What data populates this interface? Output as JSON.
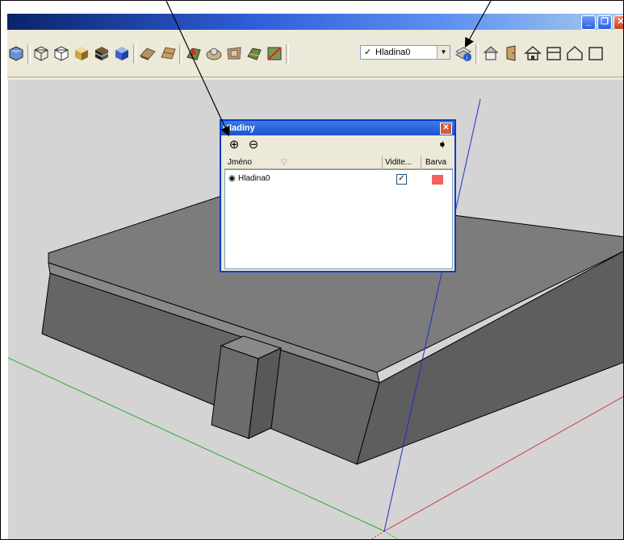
{
  "toolbar": {
    "layer_dropdown": {
      "selected": "Hladina0",
      "check": "✓"
    }
  },
  "window_buttons": {
    "minimize": "_",
    "restore": "❐",
    "close": "✕"
  },
  "dialog": {
    "title": "Hladiny",
    "add_symbol": "⊕",
    "remove_symbol": "⊖",
    "details_symbol": "➧",
    "columns": {
      "name": "Jméno",
      "visible": "Vidite...",
      "color": "Barva"
    },
    "rows": [
      {
        "name": "Hladina0",
        "visible": true,
        "visible_mark": "✓",
        "color": "#f26060",
        "active_mark": "◉"
      }
    ]
  },
  "colors": {
    "viewport_bg": "#d4d4d4",
    "model_top": "#7c7c7c",
    "model_side": "#676767",
    "axis_green": "#2ea82e",
    "axis_red": "#d23a3a",
    "axis_blue": "#1f2fd0"
  }
}
